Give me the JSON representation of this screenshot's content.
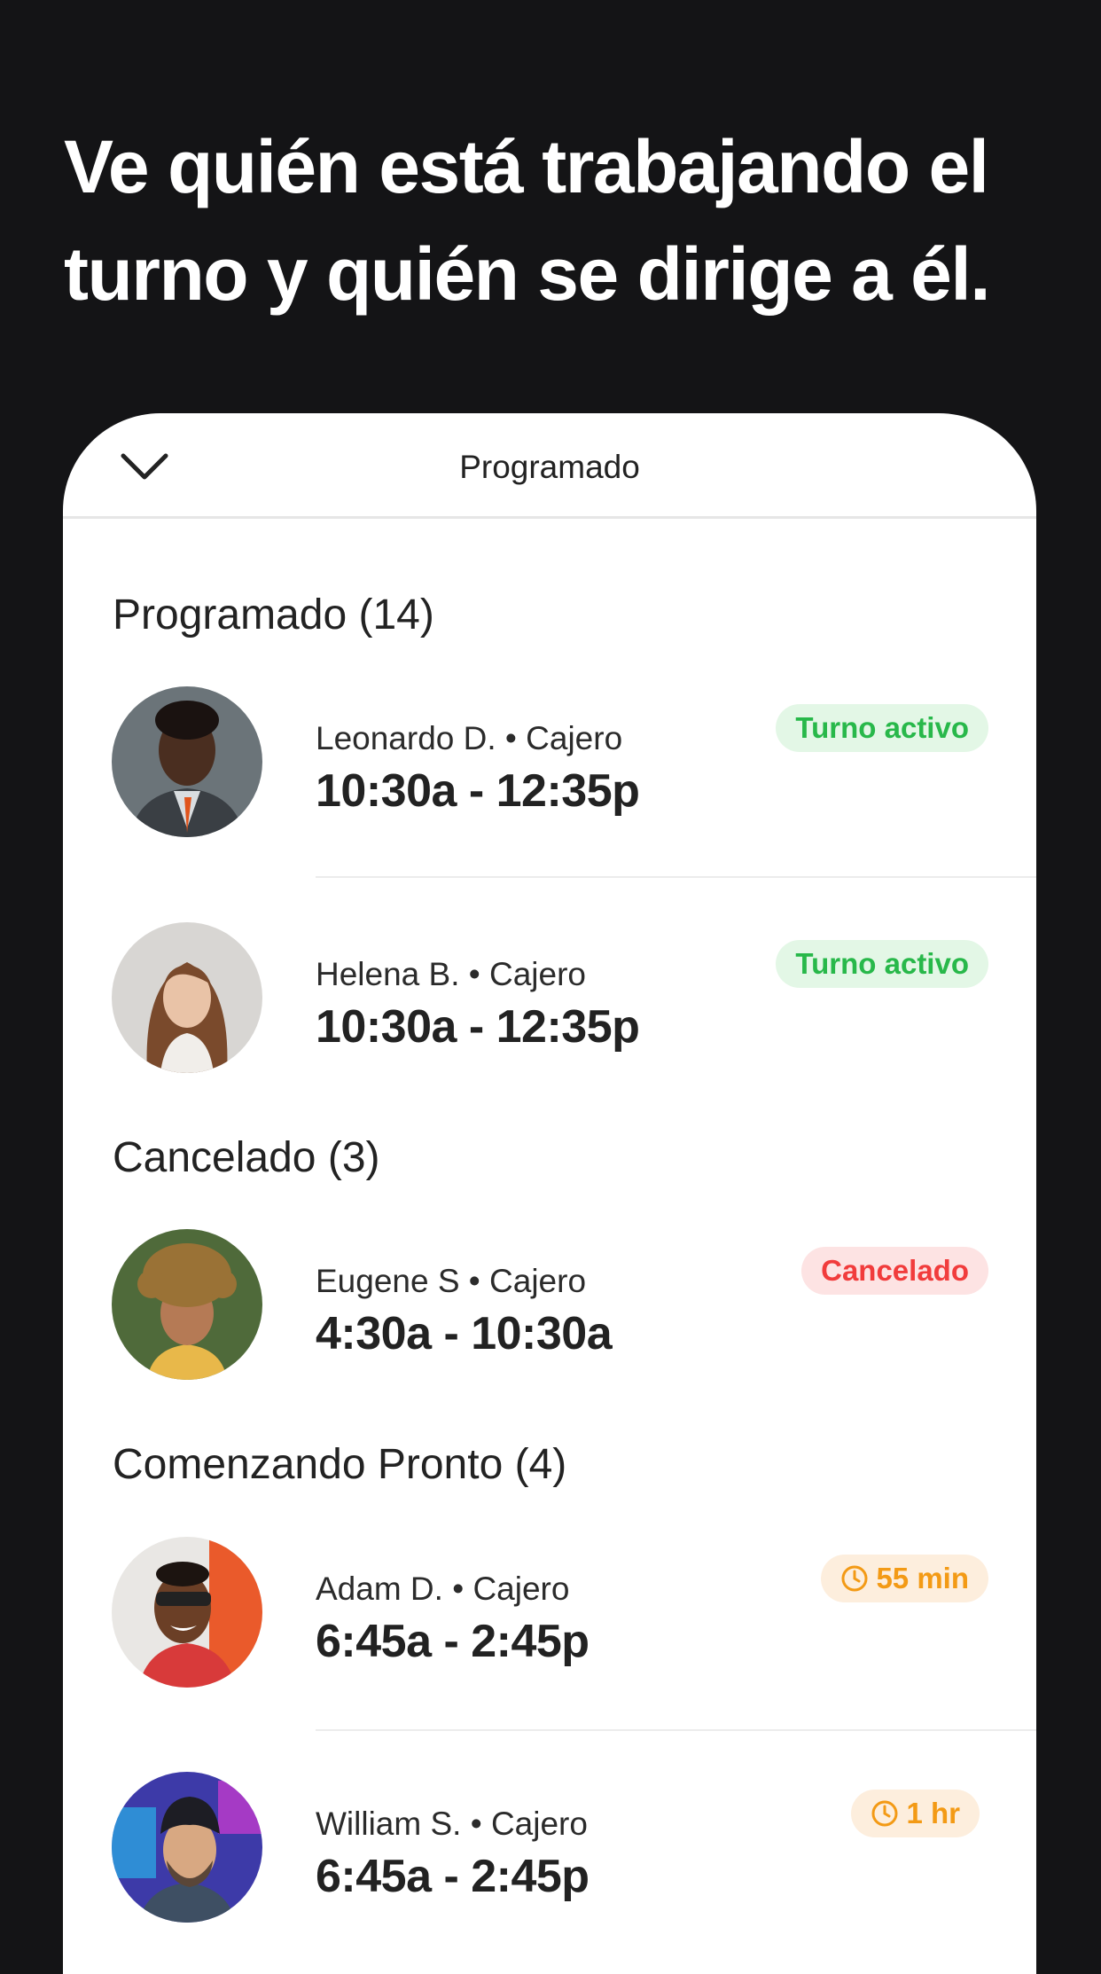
{
  "headline": {
    "line1": "Ve quién está trabajando el",
    "line2": "turno y quién se dirige a él."
  },
  "card": {
    "title": "Programado"
  },
  "sections": [
    {
      "title": "Programado (14)",
      "items": [
        {
          "meta": "Leonardo D. • Cajero",
          "time": "10:30a - 12:35p",
          "badge": "Turno activo"
        },
        {
          "meta": "Helena B. • Cajero",
          "time": "10:30a - 12:35p",
          "badge": "Turno activo"
        }
      ]
    },
    {
      "title": "Cancelado (3)",
      "items": [
        {
          "meta": "Eugene S • Cajero",
          "time": "4:30a - 10:30a",
          "badge": "Cancelado"
        }
      ]
    },
    {
      "title": "Comenzando Pronto (4)",
      "items": [
        {
          "meta": "Adam D. • Cajero",
          "time": "6:45a - 2:45p",
          "badge": "55 min",
          "badge_icon": "clock-icon"
        },
        {
          "meta": "William S. • Cajero",
          "time": "6:45a - 2:45p",
          "badge": "1 hr",
          "badge_icon": "clock-icon"
        }
      ]
    }
  ],
  "colors": {
    "background": "#141416",
    "active_text": "#28b84a",
    "active_bg": "#e3f7e6",
    "canceled_text": "#f13c3c",
    "canceled_bg": "#fde3e3",
    "soon_text": "#f39a15",
    "soon_bg": "#fdeedd"
  }
}
